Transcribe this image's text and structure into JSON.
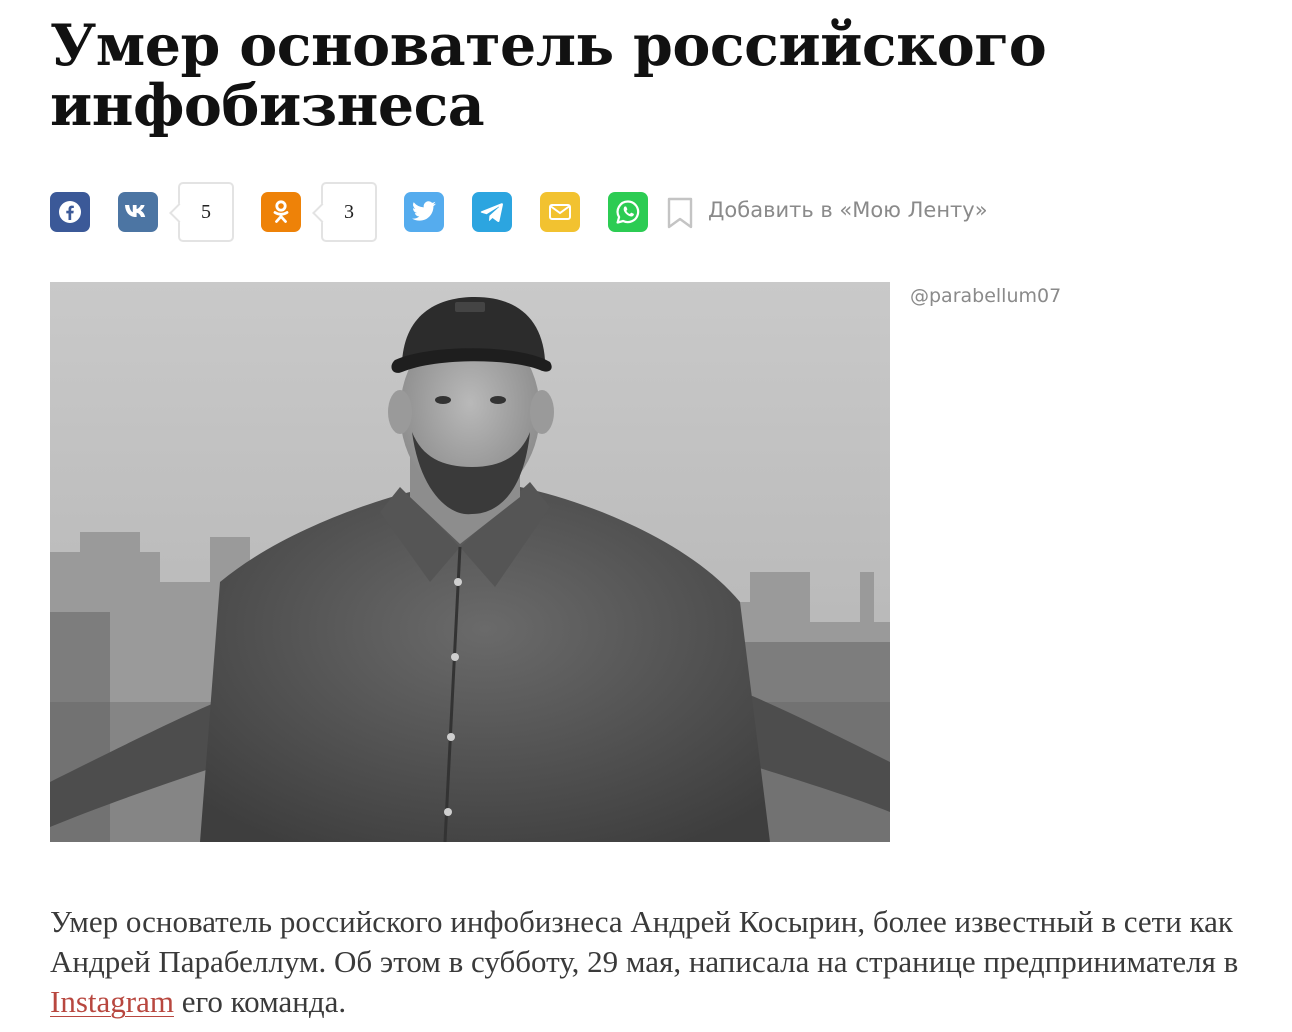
{
  "article": {
    "title": "Умер основатель российского инфобизнеса",
    "photo_credit": "@parabellum07",
    "lead_before": "Умер основатель российского инфобизнеса Андрей Косырин, более известный в сети как Андрей Парабеллум. Об этом в субботу, 29 мая, написала на странице предпринимателя в ",
    "lead_link": "Instagram",
    "lead_after": " его команда."
  },
  "share": {
    "vk_count": "5",
    "ok_count": "3",
    "add_to_feed": "Добавить в «Мою Ленту»",
    "buttons": [
      {
        "icon": "facebook-icon",
        "color": "#3b5998"
      },
      {
        "icon": "vk-icon",
        "color": "#4c75a3"
      },
      {
        "icon": "odnoklassniki-icon",
        "color": "#ee8208"
      },
      {
        "icon": "twitter-icon",
        "color": "#55acee"
      },
      {
        "icon": "telegram-icon",
        "color": "#2ca5e0"
      },
      {
        "icon": "mail-icon",
        "color": "#f2c230"
      },
      {
        "icon": "whatsapp-icon",
        "color": "#2ccc53"
      }
    ]
  },
  "colors": {
    "link": "#b8473f",
    "muted": "#8a8a8a"
  }
}
